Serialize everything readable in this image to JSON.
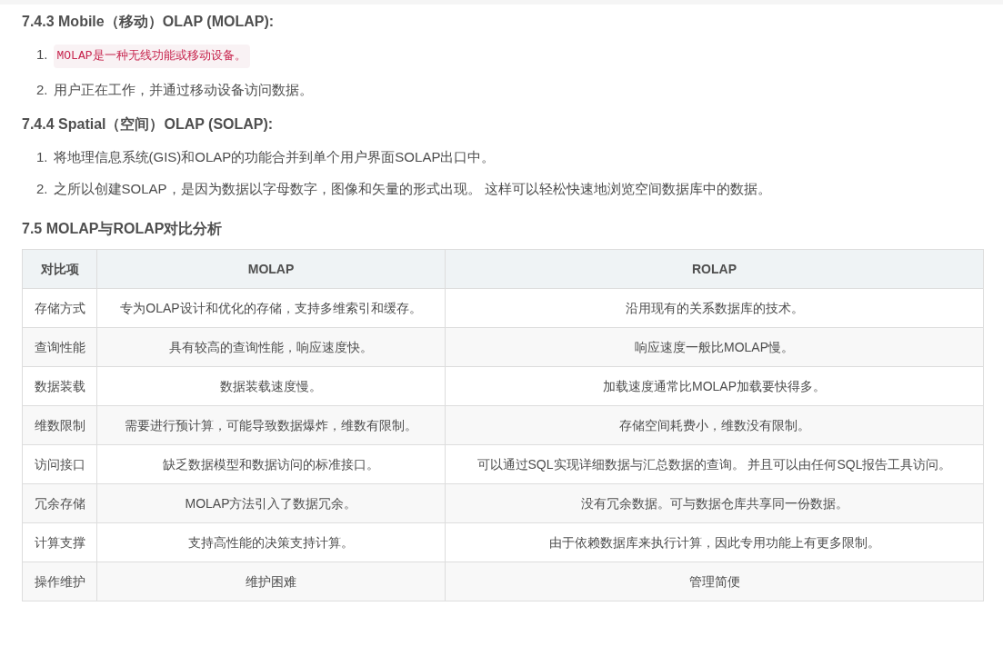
{
  "sections": [
    {
      "heading": "7.4.3 Mobile（移动）OLAP (MOLAP):",
      "items": [
        {
          "number": "1.",
          "text": "MOLAP是一种无线功能或移动设备。",
          "kind": "code"
        },
        {
          "number": "2.",
          "text": "用户正在工作，并通过移动设备访问数据。",
          "kind": "plain"
        }
      ]
    },
    {
      "heading": "7.4.4 Spatial（空间）OLAP (SOLAP):",
      "items": [
        {
          "number": "1.",
          "text": "将地理信息系统(GIS)和OLAP的功能合并到单个用户界面SOLAP出口中。",
          "kind": "plain"
        },
        {
          "number": "2.",
          "text": "之所以创建SOLAP，是因为数据以字母数字，图像和矢量的形式出现。 这样可以轻松快速地浏览空间数据库中的数据。",
          "kind": "plain"
        }
      ]
    }
  ],
  "comparison": {
    "heading": "7.5 MOLAP与ROLAP对比分析",
    "table": {
      "columns": [
        "对比项",
        "MOLAP",
        "ROLAP"
      ],
      "rows": [
        [
          "存储方式",
          "专为OLAP设计和优化的存储，支持多维索引和缓存。",
          "沿用现有的关系数据库的技术。"
        ],
        [
          "查询性能",
          "具有较高的查询性能，响应速度快。",
          "响应速度一般比MOLAP慢。"
        ],
        [
          "数据装载",
          "数据装载速度慢。",
          "加载速度通常比MOLAP加载要快得多。"
        ],
        [
          "维数限制",
          "需要进行预计算，可能导致数据爆炸，维数有限制。",
          "存储空间耗费小，维数没有限制。"
        ],
        [
          "访问接口",
          "缺乏数据模型和数据访问的标准接口。",
          "可以通过SQL实现详细数据与汇总数据的查询。 并且可以由任何SQL报告工具访问。"
        ],
        [
          "冗余存储",
          "MOLAP方法引入了数据冗余。",
          "没有冗余数据。可与数据仓库共享同一份数据。"
        ],
        [
          "计算支撑",
          "支持高性能的决策支持计算。",
          "由于依赖数据库来执行计算，因此专用功能上有更多限制。"
        ],
        [
          "操作维护",
          "维护困难",
          "管理简便"
        ]
      ]
    }
  }
}
